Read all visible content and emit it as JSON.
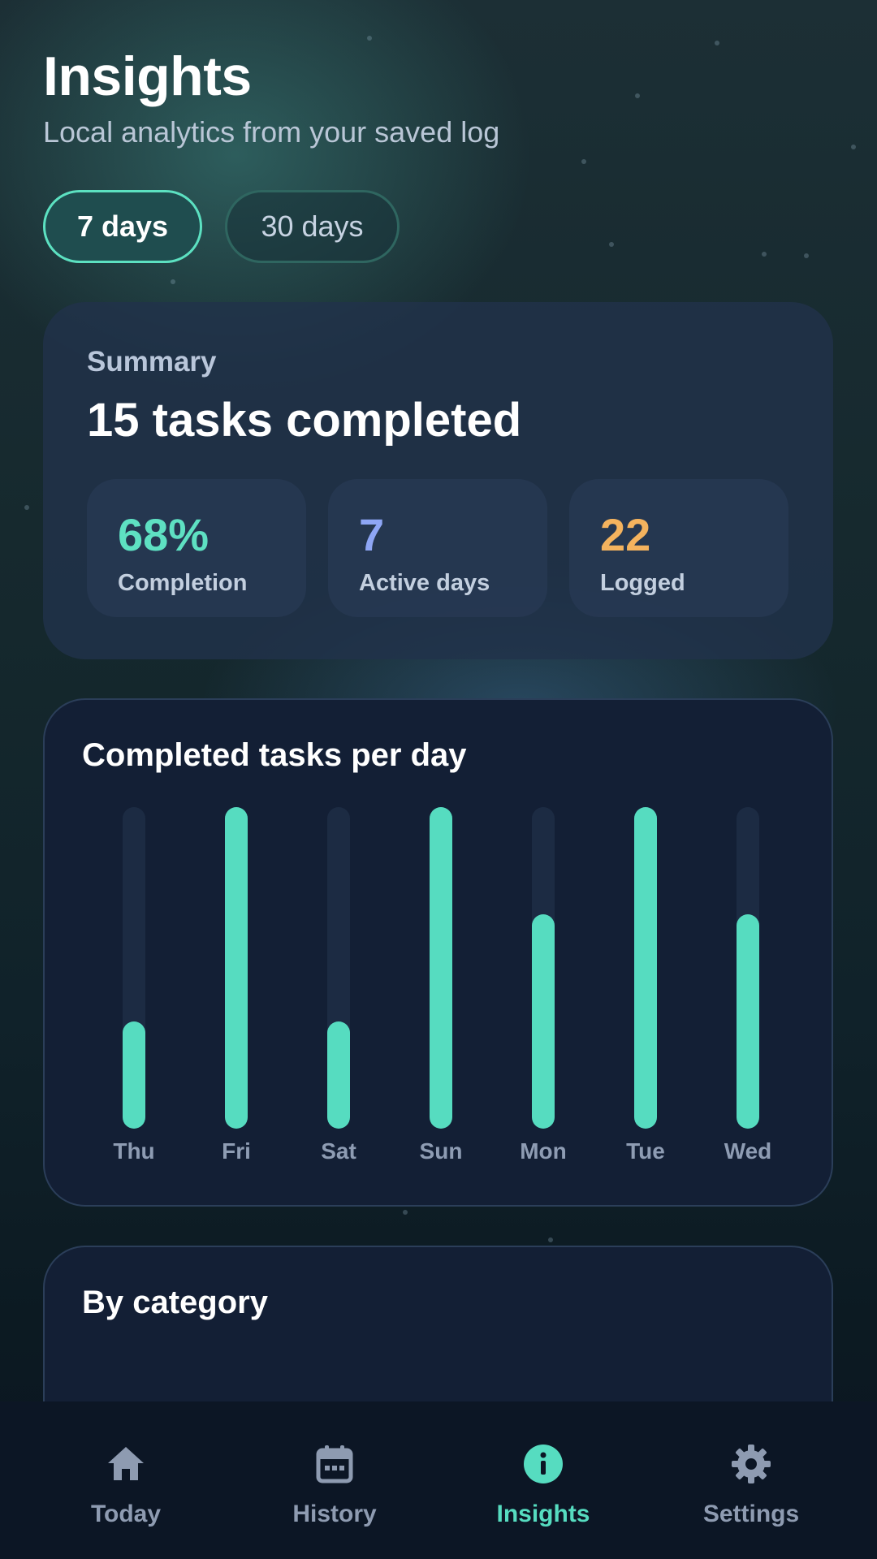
{
  "header": {
    "title": "Insights",
    "subtitle": "Local analytics from your saved log"
  },
  "range_toggle": {
    "options": [
      "7 days",
      "30 days"
    ],
    "selected": "7 days"
  },
  "summary": {
    "label": "Summary",
    "headline": "15 tasks completed",
    "stats": [
      {
        "value": "68%",
        "label": "Completion",
        "color": "#5ee0c2"
      },
      {
        "value": "7",
        "label": "Active days",
        "color": "#8ea6f5"
      },
      {
        "value": "22",
        "label": "Logged",
        "color": "#f4b35e"
      }
    ]
  },
  "daily_chart": {
    "title": "Completed tasks per day",
    "chart_data": {
      "type": "bar",
      "categories": [
        "Thu",
        "Fri",
        "Sat",
        "Sun",
        "Mon",
        "Tue",
        "Wed"
      ],
      "values": [
        1,
        3,
        1,
        3,
        2,
        3,
        2
      ],
      "ylim": [
        0,
        3
      ],
      "bar_color": "#56dcc0"
    }
  },
  "category_chart": {
    "title": "By category",
    "colors": [
      "#f4b35e",
      "#b48cf7",
      "#7ea0fa"
    ]
  },
  "nav": {
    "items": [
      {
        "label": "Today",
        "icon": "home-icon"
      },
      {
        "label": "History",
        "icon": "calendar-icon"
      },
      {
        "label": "Insights",
        "icon": "info-icon"
      },
      {
        "label": "Settings",
        "icon": "gear-icon"
      }
    ],
    "active": "Insights",
    "active_color": "#56dcc0"
  }
}
